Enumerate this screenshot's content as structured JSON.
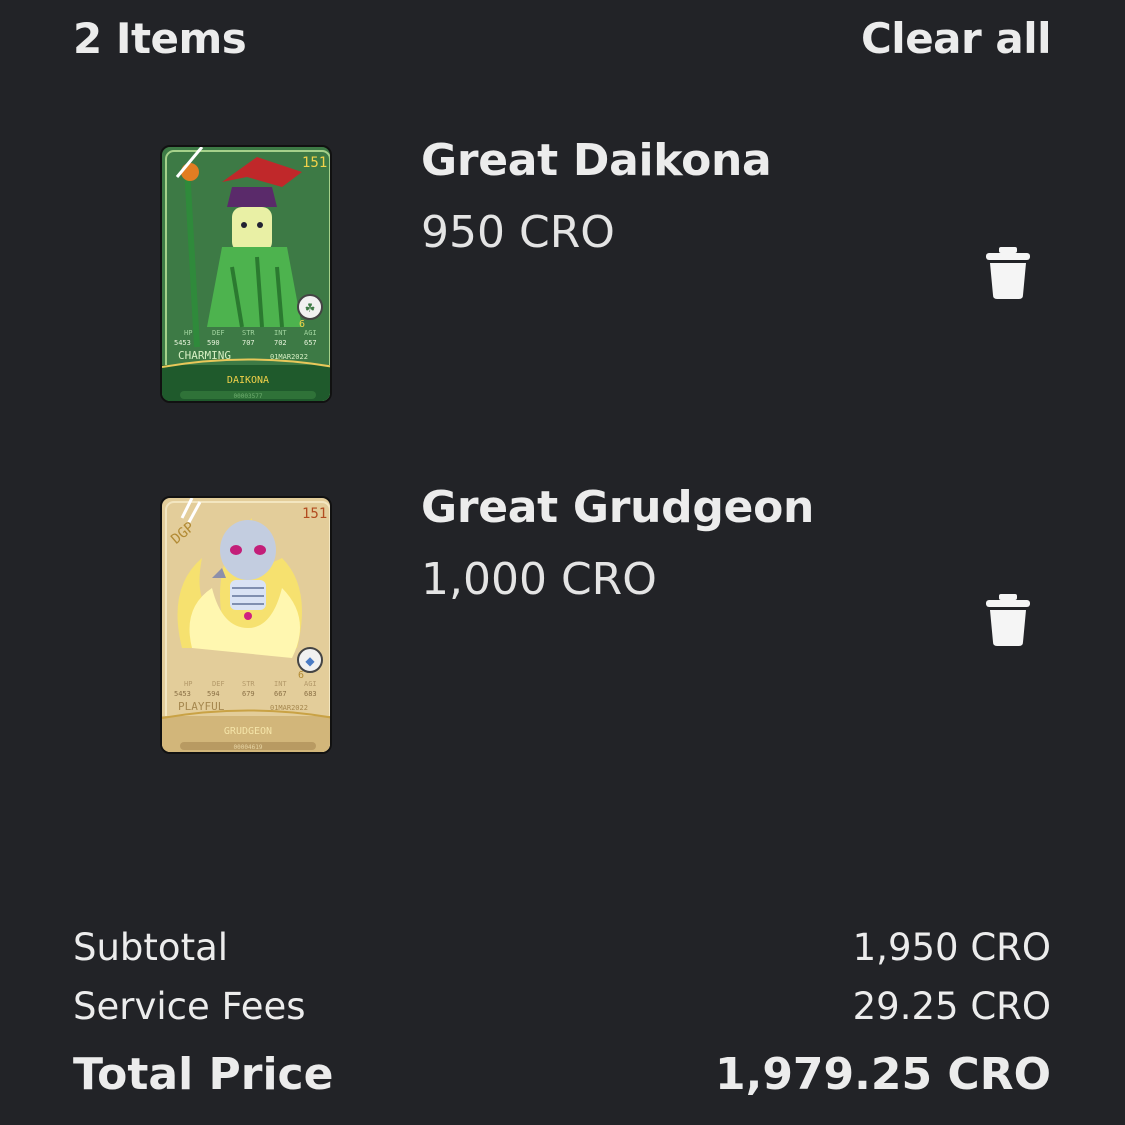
{
  "header": {
    "count_label": "2 Items",
    "clear_label": "Clear all"
  },
  "items": [
    {
      "name": "Great Daikona",
      "price": "950 CRO",
      "card": {
        "theme": "green",
        "bg": "#3d7a45",
        "bg_dark": "#1f5a2c",
        "accent": "#e8c85a",
        "trait": "CHARMING",
        "date": "01MAR2022",
        "label": "DAIKONA",
        "serial": "00003577",
        "stat_names": [
          "HP",
          "DEF",
          "STR",
          "INT",
          "AGI"
        ],
        "stat_values": [
          "5453",
          "590",
          "707",
          "702",
          "657"
        ]
      }
    },
    {
      "name": "Great Grudgeon",
      "price": "1,000 CRO",
      "card": {
        "theme": "gold",
        "bg": "#e3cd9a",
        "bg_dark": "#b89a62",
        "accent": "#c9a245",
        "trait": "PLAYFUL",
        "date": "01MAR2022",
        "label": "GRUDGEON",
        "serial": "00004619",
        "stat_names": [
          "HP",
          "DEF",
          "STR",
          "INT",
          "AGI"
        ],
        "stat_values": [
          "5453",
          "594",
          "679",
          "667",
          "683"
        ]
      }
    }
  ],
  "summary": {
    "subtotal_label": "Subtotal",
    "subtotal_value": "1,950 CRO",
    "fees_label": "Service Fees",
    "fees_value": "29.25 CRO",
    "total_label": "Total Price",
    "total_value": "1,979.25 CRO"
  }
}
